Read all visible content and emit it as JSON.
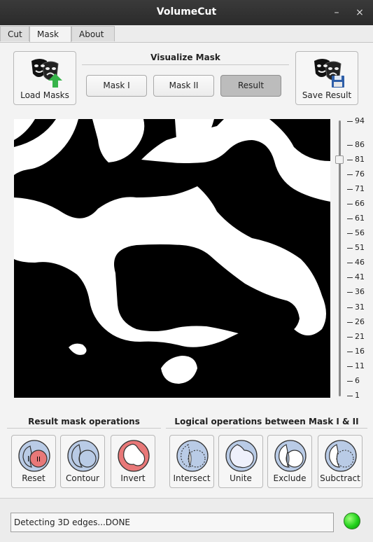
{
  "window": {
    "title": "VolumeCut",
    "minimize": "–",
    "close": "×"
  },
  "tabs": [
    {
      "label": "Cut"
    },
    {
      "label": "Mask"
    },
    {
      "label": "About"
    }
  ],
  "mask_panel": {
    "load_masks_label": "Load Masks",
    "save_result_label": "Save Result",
    "visualize_title": "Visualize Mask",
    "visualize_buttons": [
      {
        "label": "Mask I"
      },
      {
        "label": "Mask II"
      },
      {
        "label": "Result",
        "pressed": true
      }
    ]
  },
  "slice_slider": {
    "min": 1,
    "max": 94,
    "value": 81,
    "tick_labels": [
      "94",
      "86",
      "81",
      "76",
      "71",
      "66",
      "61",
      "56",
      "51",
      "46",
      "41",
      "36",
      "31",
      "26",
      "21",
      "16",
      "11",
      "6",
      "1"
    ]
  },
  "result_ops": {
    "title": "Result mask operations",
    "buttons": [
      {
        "label": "Reset",
        "icon": "reset-icon"
      },
      {
        "label": "Contour",
        "icon": "contour-icon"
      },
      {
        "label": "Invert",
        "icon": "invert-icon"
      }
    ]
  },
  "logical_ops": {
    "title": "Logical operations between Mask I & II",
    "buttons": [
      {
        "label": "Intersect",
        "icon": "intersect-icon"
      },
      {
        "label": "Unite",
        "icon": "unite-icon"
      },
      {
        "label": "Exclude",
        "icon": "exclude-icon"
      },
      {
        "label": "Subctract",
        "icon": "subtract-icon"
      }
    ]
  },
  "status": {
    "text": "Detecting 3D edges...DONE",
    "indicator_color": "#21d21b"
  },
  "colors": {
    "accent_red": "#e87878",
    "icon_blue": "#b9cbe6"
  }
}
